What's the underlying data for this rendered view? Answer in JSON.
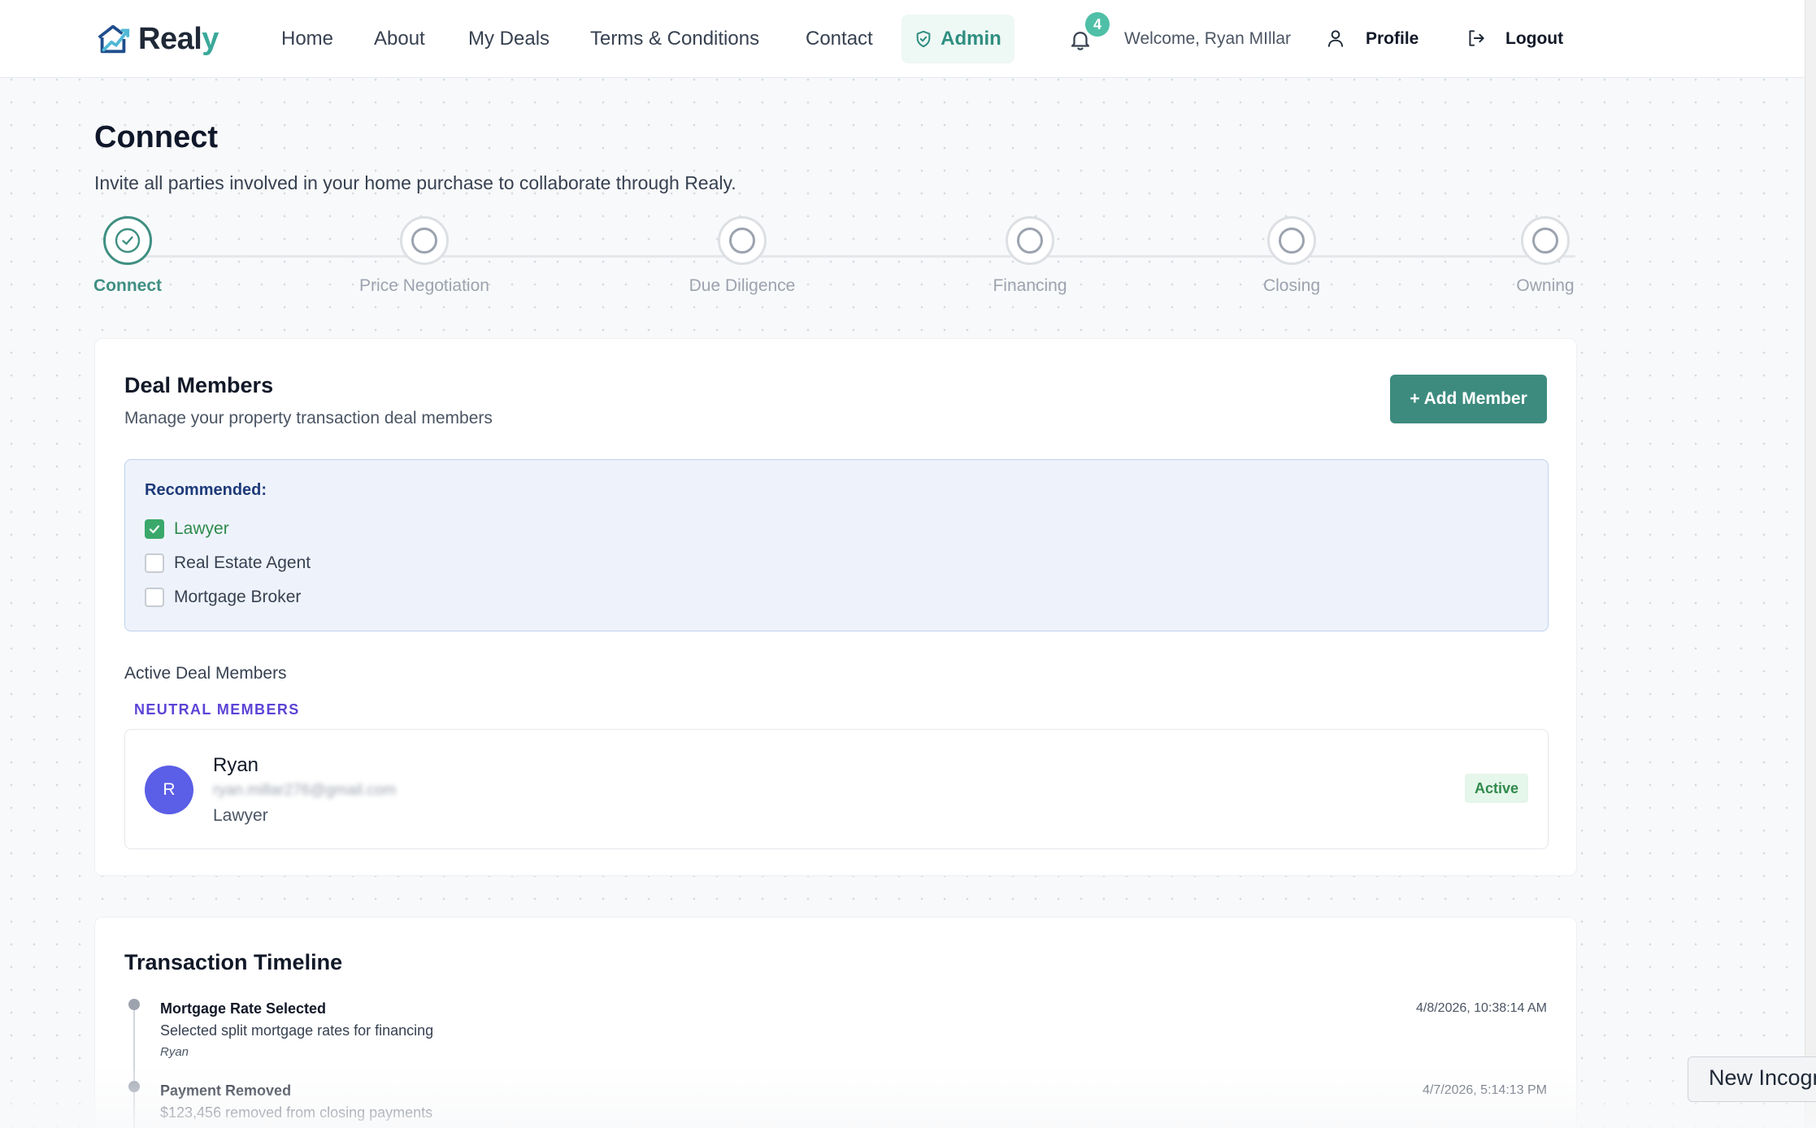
{
  "brand": {
    "name_main": "Real",
    "name_accent": "y",
    "logo_icon": "house-logo-icon"
  },
  "nav": {
    "links": [
      "Home",
      "About",
      "My Deals",
      "Terms & Conditions",
      "Contact"
    ],
    "admin_label": "Admin",
    "notification_count": "4",
    "welcome": "Welcome, Ryan MIllar",
    "profile_label": "Profile",
    "logout_label": "Logout"
  },
  "header": {
    "title": "Connect",
    "subtitle": "Invite all parties involved in your home purchase to collaborate through Realy."
  },
  "stepper": {
    "steps": [
      {
        "label": "Connect",
        "status": "complete"
      },
      {
        "label": "Price Negotiation",
        "status": "pending"
      },
      {
        "label": "Due Diligence",
        "status": "pending"
      },
      {
        "label": "Financing",
        "status": "pending"
      },
      {
        "label": "Closing",
        "status": "pending"
      },
      {
        "label": "Owning",
        "status": "pending"
      }
    ]
  },
  "deal_members": {
    "title": "Deal Members",
    "description": "Manage your property transaction deal members",
    "add_button": "+ Add Member",
    "recommended_title": "Recommended:",
    "recommended": [
      {
        "label": "Lawyer",
        "checked": true
      },
      {
        "label": "Real Estate Agent",
        "checked": false
      },
      {
        "label": "Mortgage Broker",
        "checked": false
      }
    ],
    "active_title": "Active Deal Members",
    "group_label": "NEUTRAL MEMBERS",
    "members": [
      {
        "initial": "R",
        "name": "Ryan",
        "email": "ryan.millar276@gmail.com",
        "role": "Lawyer",
        "status": "Active"
      }
    ]
  },
  "timeline": {
    "title": "Transaction Timeline",
    "events": [
      {
        "event": "Mortgage Rate Selected",
        "description": "Selected split mortgage rates for financing",
        "actor": "Ryan",
        "time": "4/8/2026, 10:38:14 AM"
      },
      {
        "event": "Payment Removed",
        "description": "$123,456 removed from closing payments",
        "actor": "",
        "time": "4/7/2026, 5:14:13 PM"
      }
    ]
  },
  "popup": {
    "label": "New Incognito"
  },
  "colors": {
    "accent": "#3d8b7f",
    "brand_accent": "#3aa89a",
    "neutral_label": "#5b44d6",
    "avatar": "#5b5ee6"
  }
}
